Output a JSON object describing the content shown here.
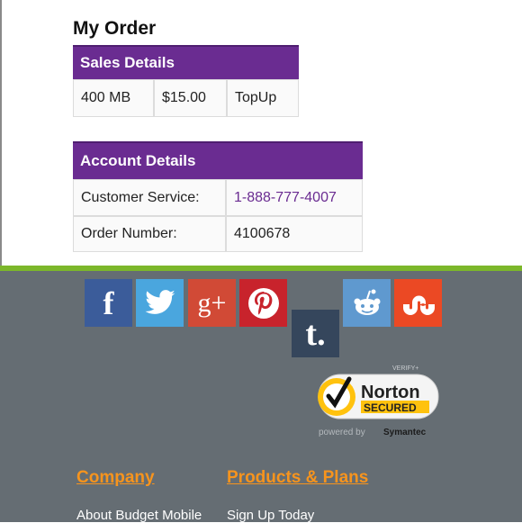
{
  "page": {
    "title": "My Order"
  },
  "sales_details": {
    "header": "Sales Details",
    "data": "400 MB",
    "price": "$15.00",
    "type": "TopUp"
  },
  "account_details": {
    "header": "Account Details",
    "rows": [
      {
        "label": "Customer Service:",
        "value": "1-888-777-4007"
      },
      {
        "label": "Order Number:",
        "value": "4100678"
      }
    ]
  },
  "social": {
    "facebook_glyph": "f",
    "googleplus_glyph": "g+",
    "tumblr_glyph": "t."
  },
  "norton": {
    "verify": "VERIFY+",
    "brand": "Norton",
    "secured": "SECURED",
    "powered_by": "powered by",
    "company": "Symantec"
  },
  "footer": {
    "company_heading": "Company",
    "products_heading": "Products & Plans",
    "company_link": "About Budget Mobile",
    "products_link": "Sign Up Today"
  },
  "colors": {
    "purple": "#6a2c91",
    "green": "#7cb72a",
    "footer_bg": "#656d73",
    "orange": "#f7941d"
  }
}
